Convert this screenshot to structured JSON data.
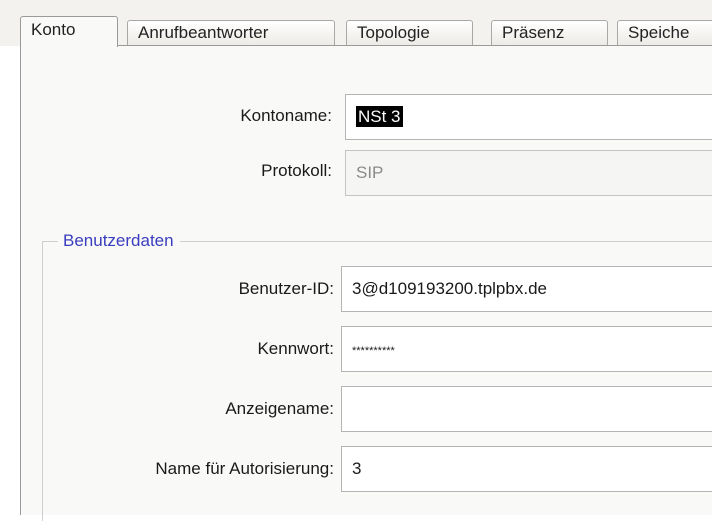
{
  "tabs": [
    {
      "label": "Konto",
      "active": true
    },
    {
      "label": "Anrufbeantworter",
      "active": false
    },
    {
      "label": "Topologie",
      "active": false
    },
    {
      "label": "Präsenz",
      "active": false
    },
    {
      "label": "Speiche",
      "active": false
    }
  ],
  "account": {
    "kontoname_label": "Kontoname:",
    "kontoname_value": "NSt 3",
    "protokoll_label": "Protokoll:",
    "protokoll_value": "SIP"
  },
  "user_data": {
    "legend": "Benutzerdaten",
    "benutzer_id_label": "Benutzer-ID:",
    "benutzer_id_value": "3@d109193200.tplpbx.de",
    "kennwort_label": "Kennwort:",
    "kennwort_value": "**********",
    "anzeigename_label": "Anzeigename:",
    "anzeigename_value": "",
    "autorisierung_label": "Name für Autorisierung:",
    "autorisierung_value": "3"
  },
  "colors": {
    "legend_text": "#3a3dbf",
    "panel_bg": "#f9f9f7",
    "selection_bg": "#000000"
  }
}
